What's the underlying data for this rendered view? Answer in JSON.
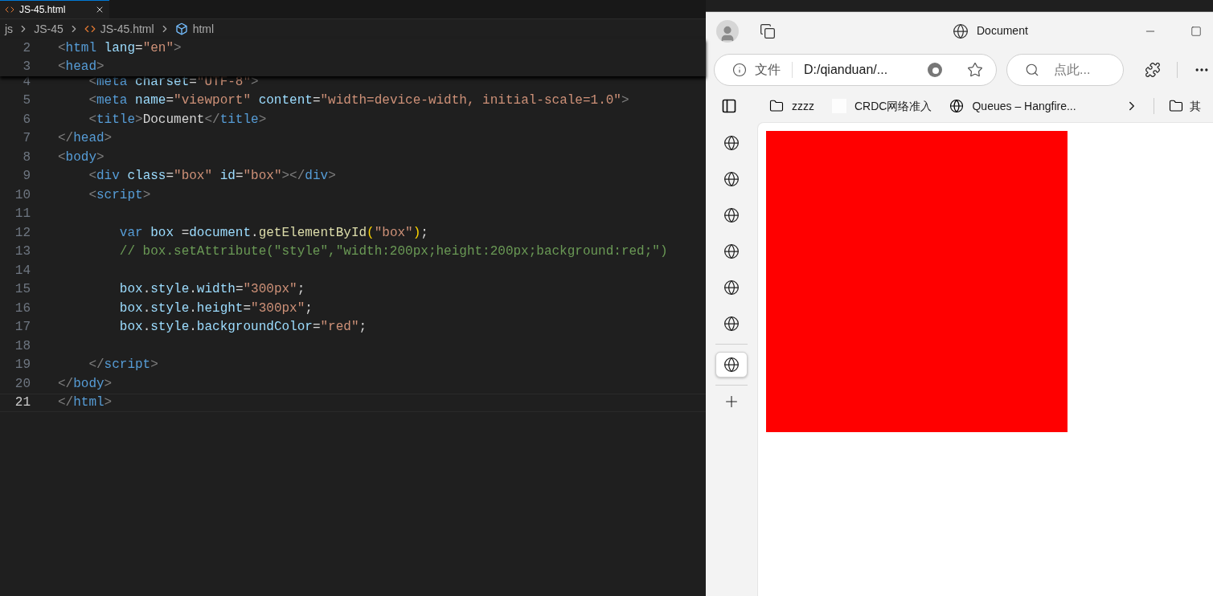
{
  "editor": {
    "tab": {
      "label": "JS-45.html",
      "selected": true
    },
    "breadcrumb": [
      "js",
      "JS-45",
      "JS-45.html",
      "html"
    ],
    "sticky_lines": [
      {
        "n": "2",
        "tokens": [
          {
            "text": "<",
            "kind": "p"
          },
          {
            "text": "html",
            "kind": "tag"
          },
          {
            "text": " lang",
            "kind": "attr"
          },
          {
            "text": "=",
            "kind": "t"
          },
          {
            "text": "\"en\"",
            "kind": "str"
          },
          {
            "text": ">",
            "kind": "p"
          }
        ]
      },
      {
        "n": "3",
        "tokens": [
          {
            "text": "<",
            "kind": "p"
          },
          {
            "text": "head",
            "kind": "tag"
          },
          {
            "text": ">",
            "kind": "p"
          }
        ]
      }
    ],
    "lines": [
      {
        "n": "4",
        "tokens": [
          {
            "text": "    <",
            "kind": "p"
          },
          {
            "text": "meta",
            "kind": "tag"
          },
          {
            "text": " charset",
            "kind": "attr"
          },
          {
            "text": "=",
            "kind": "t"
          },
          {
            "text": "\"UTF-8\"",
            "kind": "str"
          },
          {
            "text": ">",
            "kind": "p"
          }
        ]
      },
      {
        "n": "5",
        "tokens": [
          {
            "text": "    <",
            "kind": "p"
          },
          {
            "text": "meta",
            "kind": "tag"
          },
          {
            "text": " name",
            "kind": "attr"
          },
          {
            "text": "=",
            "kind": "t"
          },
          {
            "text": "\"viewport\"",
            "kind": "str"
          },
          {
            "text": " content",
            "kind": "attr"
          },
          {
            "text": "=",
            "kind": "t"
          },
          {
            "text": "\"width=device-width, initial-scale=1.0\"",
            "kind": "str"
          },
          {
            "text": ">",
            "kind": "p"
          }
        ]
      },
      {
        "n": "6",
        "tokens": [
          {
            "text": "    <",
            "kind": "p"
          },
          {
            "text": "title",
            "kind": "tag"
          },
          {
            "text": ">",
            "kind": "p"
          },
          {
            "text": "Document",
            "kind": "t"
          },
          {
            "text": "</",
            "kind": "p"
          },
          {
            "text": "title",
            "kind": "tag"
          },
          {
            "text": ">",
            "kind": "p"
          }
        ]
      },
      {
        "n": "7",
        "tokens": [
          {
            "text": "</",
            "kind": "p"
          },
          {
            "text": "head",
            "kind": "tag"
          },
          {
            "text": ">",
            "kind": "p"
          }
        ]
      },
      {
        "n": "8",
        "tokens": [
          {
            "text": "<",
            "kind": "p"
          },
          {
            "text": "body",
            "kind": "tag"
          },
          {
            "text": ">",
            "kind": "p"
          }
        ]
      },
      {
        "n": "9",
        "tokens": [
          {
            "text": "    <",
            "kind": "p"
          },
          {
            "text": "div",
            "kind": "tag"
          },
          {
            "text": " class",
            "kind": "attr"
          },
          {
            "text": "=",
            "kind": "t"
          },
          {
            "text": "\"box\"",
            "kind": "str"
          },
          {
            "text": " id",
            "kind": "attr"
          },
          {
            "text": "=",
            "kind": "t"
          },
          {
            "text": "\"box\"",
            "kind": "str"
          },
          {
            "text": "></",
            "kind": "p"
          },
          {
            "text": "div",
            "kind": "tag"
          },
          {
            "text": ">",
            "kind": "p"
          }
        ]
      },
      {
        "n": "10",
        "tokens": [
          {
            "text": "    <",
            "kind": "p"
          },
          {
            "text": "script",
            "kind": "tag"
          },
          {
            "text": ">",
            "kind": "p"
          }
        ]
      },
      {
        "n": "11"
      },
      {
        "n": "12",
        "tokens": [
          {
            "text": "        var",
            "kind": "kw"
          },
          {
            "text": " box",
            "kind": "var"
          },
          {
            "text": " =",
            "kind": "t"
          },
          {
            "text": "document",
            "kind": "var"
          },
          {
            "text": ".",
            "kind": "t"
          },
          {
            "text": "getElementById",
            "kind": "fn"
          },
          {
            "text": "(",
            "kind": "br"
          },
          {
            "text": "\"box\"",
            "kind": "str"
          },
          {
            "text": ")",
            "kind": "br"
          },
          {
            "text": ";",
            "kind": "t"
          }
        ]
      },
      {
        "n": "13",
        "tokens": [
          {
            "text": "        // box.setAttribute(\"style\",\"width:200px;height:200px;background:red;\")",
            "kind": "cm"
          }
        ]
      },
      {
        "n": "14"
      },
      {
        "n": "15",
        "tokens": [
          {
            "text": "        box",
            "kind": "var"
          },
          {
            "text": ".",
            "kind": "t"
          },
          {
            "text": "style",
            "kind": "var"
          },
          {
            "text": ".",
            "kind": "t"
          },
          {
            "text": "width",
            "kind": "var"
          },
          {
            "text": "=",
            "kind": "t"
          },
          {
            "text": "\"300px\"",
            "kind": "str"
          },
          {
            "text": ";",
            "kind": "t"
          }
        ]
      },
      {
        "n": "16",
        "tokens": [
          {
            "text": "        box",
            "kind": "var"
          },
          {
            "text": ".",
            "kind": "t"
          },
          {
            "text": "style",
            "kind": "var"
          },
          {
            "text": ".",
            "kind": "t"
          },
          {
            "text": "height",
            "kind": "var"
          },
          {
            "text": "=",
            "kind": "t"
          },
          {
            "text": "\"300px\"",
            "kind": "str"
          },
          {
            "text": ";",
            "kind": "t"
          }
        ]
      },
      {
        "n": "17",
        "tokens": [
          {
            "text": "        box",
            "kind": "var"
          },
          {
            "text": ".",
            "kind": "t"
          },
          {
            "text": "style",
            "kind": "var"
          },
          {
            "text": ".",
            "kind": "t"
          },
          {
            "text": "backgroundColor",
            "kind": "var"
          },
          {
            "text": "=",
            "kind": "t"
          },
          {
            "text": "\"red\"",
            "kind": "str"
          },
          {
            "text": ";",
            "kind": "t"
          }
        ]
      },
      {
        "n": "18"
      },
      {
        "n": "19",
        "tokens": [
          {
            "text": "    </",
            "kind": "p"
          },
          {
            "text": "script",
            "kind": "tag"
          },
          {
            "text": ">",
            "kind": "p"
          }
        ]
      },
      {
        "n": "20",
        "tokens": [
          {
            "text": "</",
            "kind": "p"
          },
          {
            "text": "body",
            "kind": "tag"
          },
          {
            "text": ">",
            "kind": "p"
          }
        ]
      },
      {
        "n": "21",
        "active": true,
        "tokens": [
          {
            "text": "</",
            "kind": "p"
          },
          {
            "text": "html",
            "kind": "tag"
          },
          {
            "text": ">",
            "kind": "p"
          }
        ]
      }
    ]
  },
  "browser": {
    "title": "Document",
    "address": {
      "scheme": "文件",
      "url": "D:/qianduan/..."
    },
    "search": {
      "placeholder": "点此..."
    },
    "favorites": [
      {
        "kind": "folder",
        "label": "zzzz"
      },
      {
        "kind": "blank",
        "label": "CRDC网络准入"
      },
      {
        "kind": "globe",
        "label": "Queues – Hangfire..."
      }
    ],
    "other_favorites": "其",
    "vertical_tabs": [
      {
        "selected": false
      },
      {
        "selected": false
      },
      {
        "selected": false
      },
      {
        "selected": false
      },
      {
        "selected": false
      },
      {
        "selected": false
      },
      {
        "selected": true
      }
    ]
  }
}
